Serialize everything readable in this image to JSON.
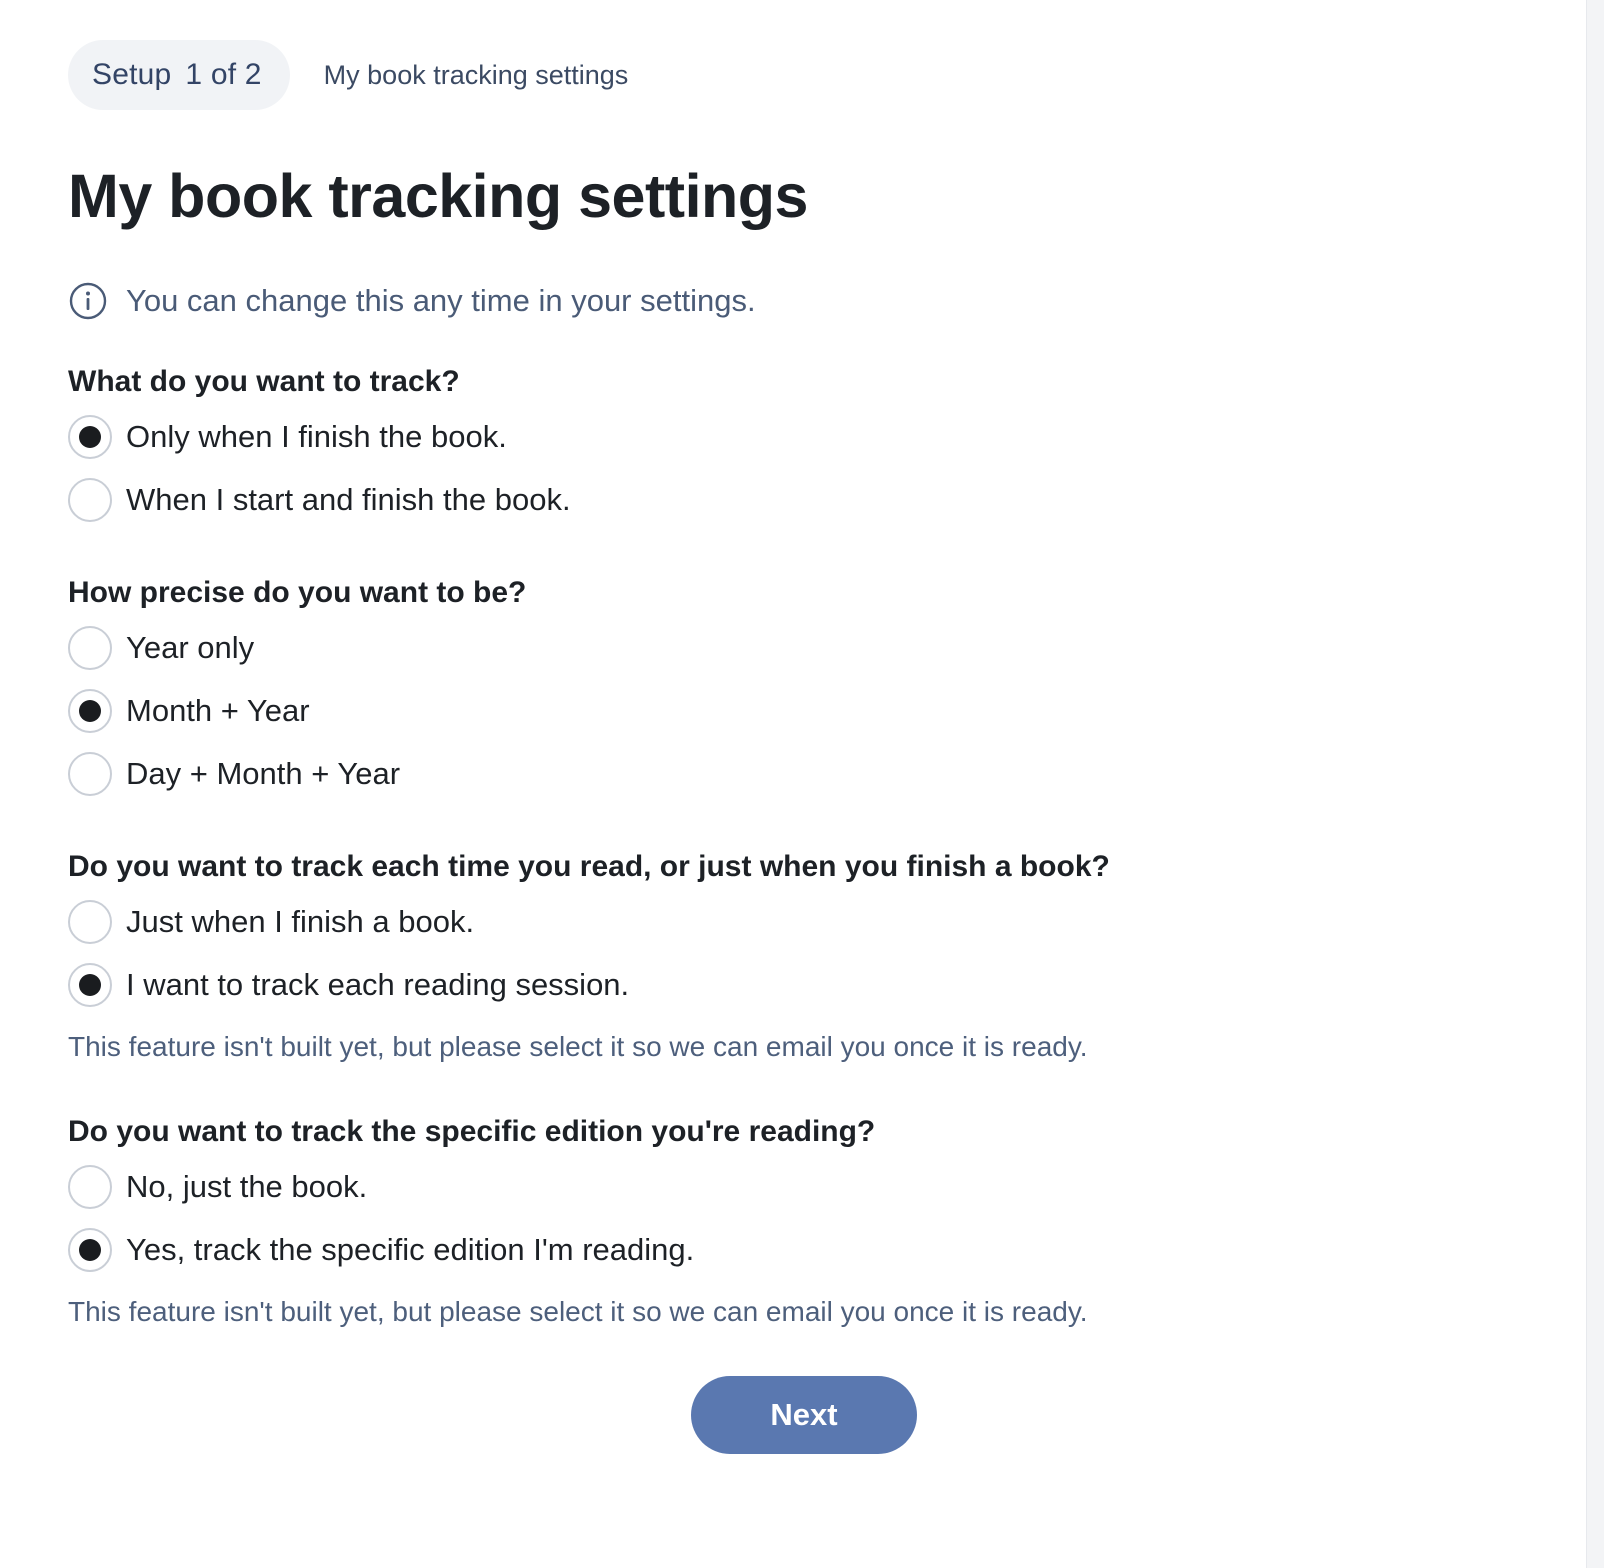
{
  "header": {
    "step_label": "Setup",
    "step_count": "1 of 2",
    "step_title": "My book tracking settings"
  },
  "page_title": "My book tracking settings",
  "info_text": "You can change this any time in your settings.",
  "questions": [
    {
      "title": "What do you want to track?",
      "options": [
        {
          "label": "Only when I finish the book.",
          "selected": true
        },
        {
          "label": "When I start and finish the book.",
          "selected": false
        }
      ],
      "note": ""
    },
    {
      "title": "How precise do you want to be?",
      "options": [
        {
          "label": "Year only",
          "selected": false
        },
        {
          "label": "Month + Year",
          "selected": true
        },
        {
          "label": "Day + Month + Year",
          "selected": false
        }
      ],
      "note": ""
    },
    {
      "title": "Do you want to track each time you read, or just when you finish a book?",
      "options": [
        {
          "label": "Just when I finish a book.",
          "selected": false
        },
        {
          "label": "I want to track each reading session.",
          "selected": true
        }
      ],
      "note": "This feature isn't built yet, but please select it so we can email you once it is ready."
    },
    {
      "title": "Do you want to track the specific edition you're reading?",
      "options": [
        {
          "label": "No, just the book.",
          "selected": false
        },
        {
          "label": "Yes, track the specific edition I'm reading.",
          "selected": true
        }
      ],
      "note": "This feature isn't built yet, but please select it so we can email you once it is ready."
    }
  ],
  "next_label": "Next",
  "colors": {
    "primary_button": "#5a78b0",
    "info_text": "#4a5b77",
    "pill_background": "#f1f3f6"
  }
}
